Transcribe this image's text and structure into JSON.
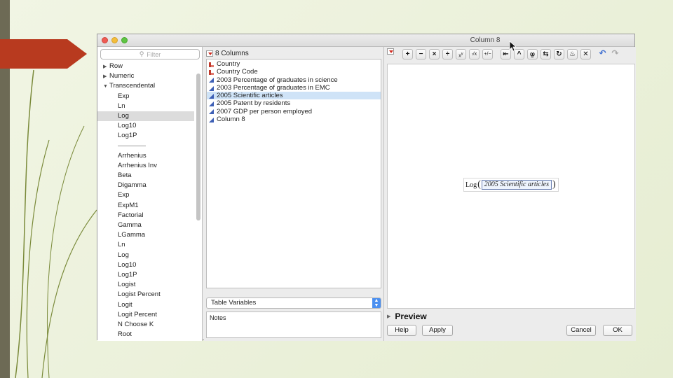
{
  "window": {
    "title": "Column 8"
  },
  "function_pane": {
    "filter_placeholder": "Filter",
    "groups": [
      {
        "label": "Row",
        "state": "collapsed"
      },
      {
        "label": "Numeric",
        "state": "collapsed"
      },
      {
        "label": "Transcendental",
        "state": "expanded"
      }
    ],
    "items": [
      "Exp",
      "Ln",
      "Log",
      "Log10",
      "Log1P"
    ],
    "selected_item": "Log",
    "more_items": [
      "Arrhenius",
      "Arrhenius Inv",
      "Beta",
      "Digamma",
      "Exp",
      "ExpM1",
      "Factorial",
      "Gamma",
      "LGamma",
      "Ln",
      "Log",
      "Log10",
      "Log1P",
      "Logist",
      "Logist Percent",
      "Logit",
      "Logit Percent",
      "N Choose K",
      "Root"
    ]
  },
  "columns_pane": {
    "header": "8 Columns",
    "columns": [
      {
        "label": "Country",
        "type": "nominal"
      },
      {
        "label": "Country Code",
        "type": "nominal"
      },
      {
        "label": "2003 Percentage of graduates in science",
        "type": "continuous"
      },
      {
        "label": "2003 Percentage of graduates in EMC",
        "type": "continuous"
      },
      {
        "label": "2005 Scientific articles",
        "type": "continuous",
        "selected": true
      },
      {
        "label": "2005 Patent by residents",
        "type": "continuous"
      },
      {
        "label": "2007 GDP per person employed",
        "type": "continuous"
      },
      {
        "label": "Column 8",
        "type": "continuous"
      }
    ],
    "source_select": "Table Variables",
    "notes_label": "Notes"
  },
  "formula_editor": {
    "toolbar": [
      "plus",
      "minus",
      "times",
      "divide",
      "x^y",
      "√x",
      "+/-",
      "insert",
      "raise",
      "peel",
      "swap",
      "local",
      "unary",
      "delete"
    ],
    "formula_function": "Log",
    "formula_argument": "2005 Scientific articles",
    "preview_label": "Preview"
  },
  "buttons": {
    "help": "Help",
    "apply": "Apply",
    "cancel": "Cancel",
    "ok": "OK"
  },
  "colors": {
    "slide_accent_red": "#b83a1f",
    "selection_blue": "#cfe3f7",
    "nominal_icon": "#c0392b",
    "continuous_icon": "#3d5fb5"
  }
}
